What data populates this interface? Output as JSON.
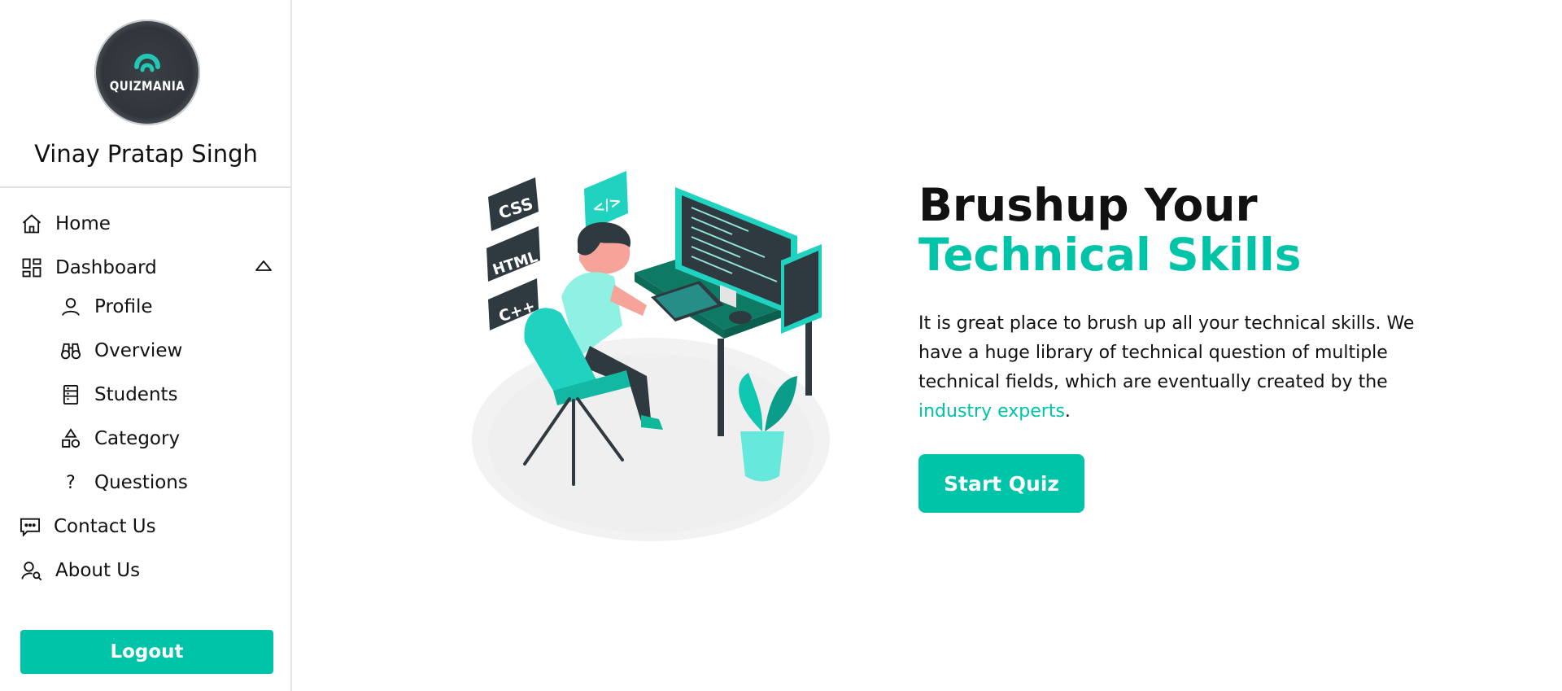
{
  "sidebar": {
    "logo_text": "QUIZMANIA",
    "username": "Vinay Pratap Singh",
    "nav": {
      "home": "Home",
      "dashboard": "Dashboard",
      "profile": "Profile",
      "overview": "Overview",
      "students": "Students",
      "category": "Category",
      "questions": "Questions",
      "contact": "Contact Us",
      "about": "About Us"
    },
    "logout_label": "Logout"
  },
  "hero": {
    "title_part1": "Brushup Your ",
    "title_accent": "Technical Skills",
    "text_main": "It is great place to brush up all your technical skills. We have a huge library of technical question of multiple technical fields, which are eventually created by the ",
    "text_accent": "industry experts",
    "text_end": ".",
    "button_label": "Start Quiz"
  },
  "illustration": {
    "labels": [
      "CSS",
      "HTML",
      "C++",
      "</>"
    ]
  },
  "colors": {
    "accent": "#00c4a7",
    "dark": "#2f3a40"
  },
  "icons": {
    "home": "home-icon",
    "dashboard": "dashboard-icon",
    "profile": "person-icon",
    "overview": "binoculars-icon",
    "students": "list-icon",
    "category": "shapes-icon",
    "questions": "question-icon",
    "contact": "chat-icon",
    "about": "person-search-icon"
  }
}
